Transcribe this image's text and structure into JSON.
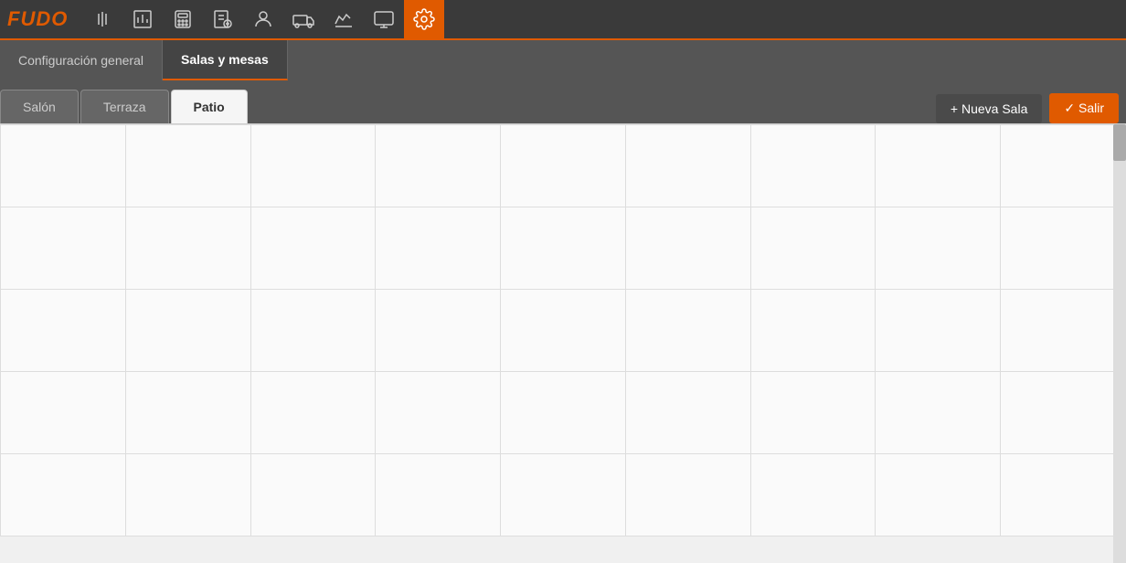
{
  "app": {
    "logo": "FUDO"
  },
  "navbar": {
    "icons": [
      {
        "name": "menu-icon",
        "label": "Menú",
        "active": false
      },
      {
        "name": "reports-icon",
        "label": "Reportes",
        "active": false
      },
      {
        "name": "calculator-icon",
        "label": "Calculadora",
        "active": false
      },
      {
        "name": "orders-icon",
        "label": "Pedidos",
        "active": false
      },
      {
        "name": "users-icon",
        "label": "Usuarios",
        "active": false
      },
      {
        "name": "delivery-icon",
        "label": "Delivery",
        "active": false
      },
      {
        "name": "stats-icon",
        "label": "Estadísticas",
        "active": false
      },
      {
        "name": "monitor-icon",
        "label": "Monitor",
        "active": false
      },
      {
        "name": "settings-icon",
        "label": "Configuración",
        "active": true
      }
    ]
  },
  "sub_navbar": {
    "items": [
      {
        "label": "Configuración general",
        "active": false
      },
      {
        "label": "Salas y mesas",
        "active": true
      }
    ]
  },
  "tabs": {
    "items": [
      {
        "label": "Salón",
        "active": false
      },
      {
        "label": "Terraza",
        "active": false
      },
      {
        "label": "Patio",
        "active": true
      }
    ],
    "nueva_sala_label": "+ Nueva Sala",
    "salir_label": "✓ Salir"
  },
  "grid": {
    "cols": 9,
    "rows": 5
  }
}
